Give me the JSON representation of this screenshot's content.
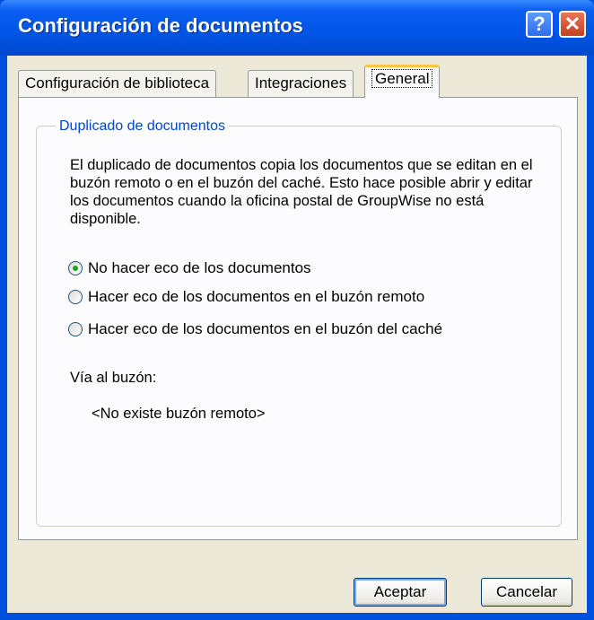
{
  "window": {
    "title": "Configuración de documentos",
    "help_label": "?",
    "close_label": "✕"
  },
  "tabs": [
    {
      "label": "Configuración de biblioteca",
      "selected": false
    },
    {
      "label": "Integraciones",
      "selected": false
    },
    {
      "label": "General",
      "selected": true
    }
  ],
  "group": {
    "title": "Duplicado de documentos",
    "description": "El duplicado de documentos copia los documentos que se editan en el buzón remoto o en el buzón del caché. Esto hace posible abrir y editar los documentos cuando la oficina postal de GroupWise no está disponible.",
    "options": [
      {
        "label": "No hacer eco de los documentos",
        "selected": true
      },
      {
        "label": "Hacer eco de los documentos en el buzón remoto",
        "selected": false
      },
      {
        "label": "Hacer eco de los documentos en el buzón del caché",
        "selected": false
      }
    ],
    "path_label": "Vía al buzón:",
    "path_value": "<No existe buzón remoto>"
  },
  "buttons": {
    "ok": "Aceptar",
    "cancel": "Cancelar"
  },
  "colors": {
    "titlebar": "#0055E5",
    "dialog_bg": "#ECE9D8",
    "group_title": "#0046D5",
    "selected_tab_accent": "#FFC83C"
  }
}
